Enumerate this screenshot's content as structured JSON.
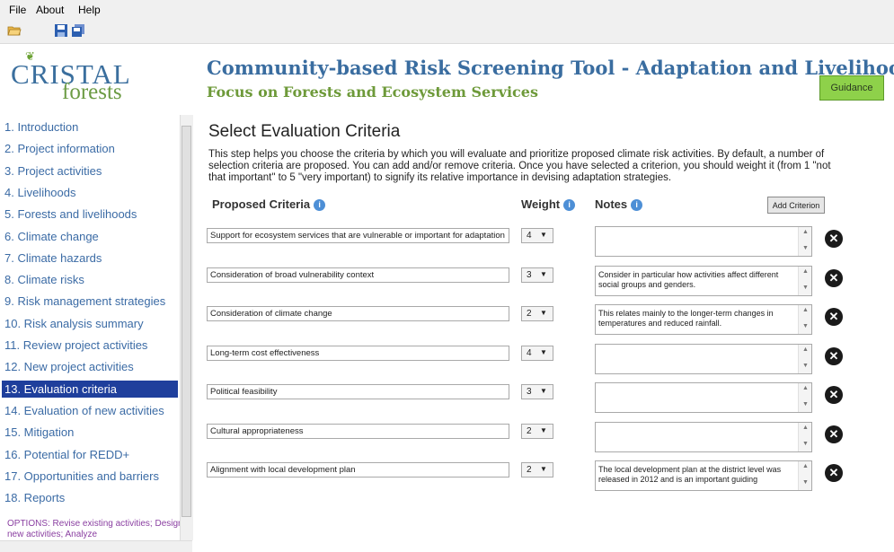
{
  "menu": {
    "file": "File",
    "about": "About",
    "help": "Help"
  },
  "toolbar": {
    "open_icon": "folder-open-icon",
    "save_icon": "save-icon",
    "save_all_icon": "save-all-icon"
  },
  "header": {
    "logo_top": "CRISTAL",
    "logo_bottom": "forests",
    "title": "Community-based Risk Screening Tool - Adaptation and Livelihoods",
    "subtitle": "Focus on Forests and Ecosystem Services",
    "guidance_label": "Guidance"
  },
  "sidebar": {
    "items": [
      {
        "label": "1. Introduction"
      },
      {
        "label": "2. Project information"
      },
      {
        "label": "3. Project activities"
      },
      {
        "label": "4. Livelihoods"
      },
      {
        "label": "5. Forests and livelihoods"
      },
      {
        "label": "6. Climate change"
      },
      {
        "label": "7. Climate hazards"
      },
      {
        "label": "8. Climate risks"
      },
      {
        "label": "9. Risk management strategies"
      },
      {
        "label": "10. Risk analysis summary"
      },
      {
        "label": "11. Review project activities"
      },
      {
        "label": "12. New project activities"
      },
      {
        "label": "13. Evaluation criteria"
      },
      {
        "label": "14. Evaluation of new activities"
      },
      {
        "label": "15. Mitigation"
      },
      {
        "label": "16. Potential for REDD+"
      },
      {
        "label": "17. Opportunities and barriers"
      },
      {
        "label": "18. Reports"
      }
    ],
    "active_index": 12,
    "options_text": "OPTIONS: Revise existing activities; Design new activities; Analyze"
  },
  "main": {
    "title": "Select Evaluation Criteria",
    "description": "This step helps you choose the criteria by which you will evaluate and prioritize proposed climate risk activities. By default, a number of selection criteria are proposed. You can add and/or remove criteria. Once you have selected a criterion, you should weight it (from 1 \"not that important\" to 5 \"very important) to signify its relative importance in devising adaptation strategies.",
    "col_criteria": "Proposed Criteria",
    "col_weight": "Weight",
    "col_notes": "Notes",
    "add_button": "Add Criterion",
    "rows": [
      {
        "criterion": "Support for ecosystem services that are vulnerable or important for adaptation",
        "weight": "4",
        "notes": ""
      },
      {
        "criterion": "Consideration of broad vulnerability context",
        "weight": "3",
        "notes": "Consider in particular how activities affect different social groups and genders."
      },
      {
        "criterion": "Consideration of climate change",
        "weight": "2",
        "notes": "This relates mainly to the longer-term changes in temperatures and reduced rainfall."
      },
      {
        "criterion": "Long-term cost effectiveness",
        "weight": "4",
        "notes": ""
      },
      {
        "criterion": "Political feasibility",
        "weight": "3",
        "notes": ""
      },
      {
        "criterion": "Cultural appropriateness",
        "weight": "2",
        "notes": ""
      },
      {
        "criterion": "Alignment with local development plan",
        "weight": "2",
        "notes": "The local development plan at the district level was released in 2012 and is an important guiding"
      }
    ]
  }
}
